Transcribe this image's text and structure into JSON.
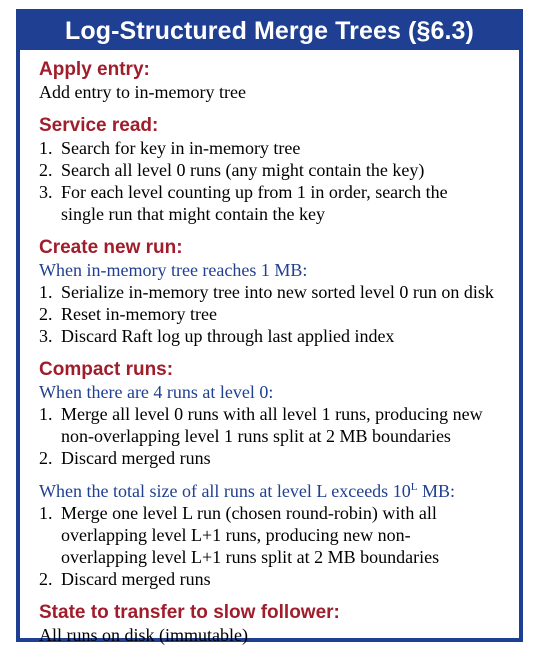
{
  "title": "Log-Structured Merge Trees (§6.3)",
  "apply": {
    "heading": "Apply entry:",
    "text": "Add entry to in-memory tree"
  },
  "read": {
    "heading": "Service read:",
    "items": [
      {
        "num": "1.",
        "text": "Search for key in in-memory tree"
      },
      {
        "num": "2.",
        "text": "Search all level 0 runs (any might contain the key)"
      },
      {
        "num": "3.",
        "text": "For each level counting up from 1 in order, search the\nsingle run that might contain the key"
      }
    ]
  },
  "create": {
    "heading": "Create new run:",
    "condition": "When in-memory tree reaches 1 MB:",
    "items": [
      {
        "num": "1.",
        "text": "Serialize in-memory tree into new sorted level 0 run on disk"
      },
      {
        "num": "2.",
        "text": "Reset in-memory tree"
      },
      {
        "num": "3.",
        "text": "Discard Raft log up through last applied index"
      }
    ]
  },
  "compact": {
    "heading": "Compact runs:",
    "condition1": "When there are 4 runs at level 0:",
    "items1": [
      {
        "num": "1.",
        "text": "Merge all level 0 runs with all level 1 runs, producing new\nnon-overlapping level 1 runs split at 2 MB boundaries"
      },
      {
        "num": "2.",
        "text": "Discard merged runs"
      }
    ],
    "condition2_prefix": "When the total size of all runs at level L exceeds 10",
    "condition2_exponent": "L",
    "condition2_suffix": " MB:",
    "items2": [
      {
        "num": "1.",
        "text": "Merge one level L run (chosen round-robin) with all\noverlapping level L+1 runs, producing new non-\noverlapping level L+1 runs split at 2 MB boundaries"
      },
      {
        "num": "2.",
        "text": "Discard merged runs"
      }
    ]
  },
  "transfer": {
    "heading": "State to transfer to slow follower:",
    "text": "All runs on disk (immutable)"
  },
  "colors": {
    "frame": "#1f3f93",
    "heading": "#a01e2b",
    "condition": "#1f3f93"
  }
}
